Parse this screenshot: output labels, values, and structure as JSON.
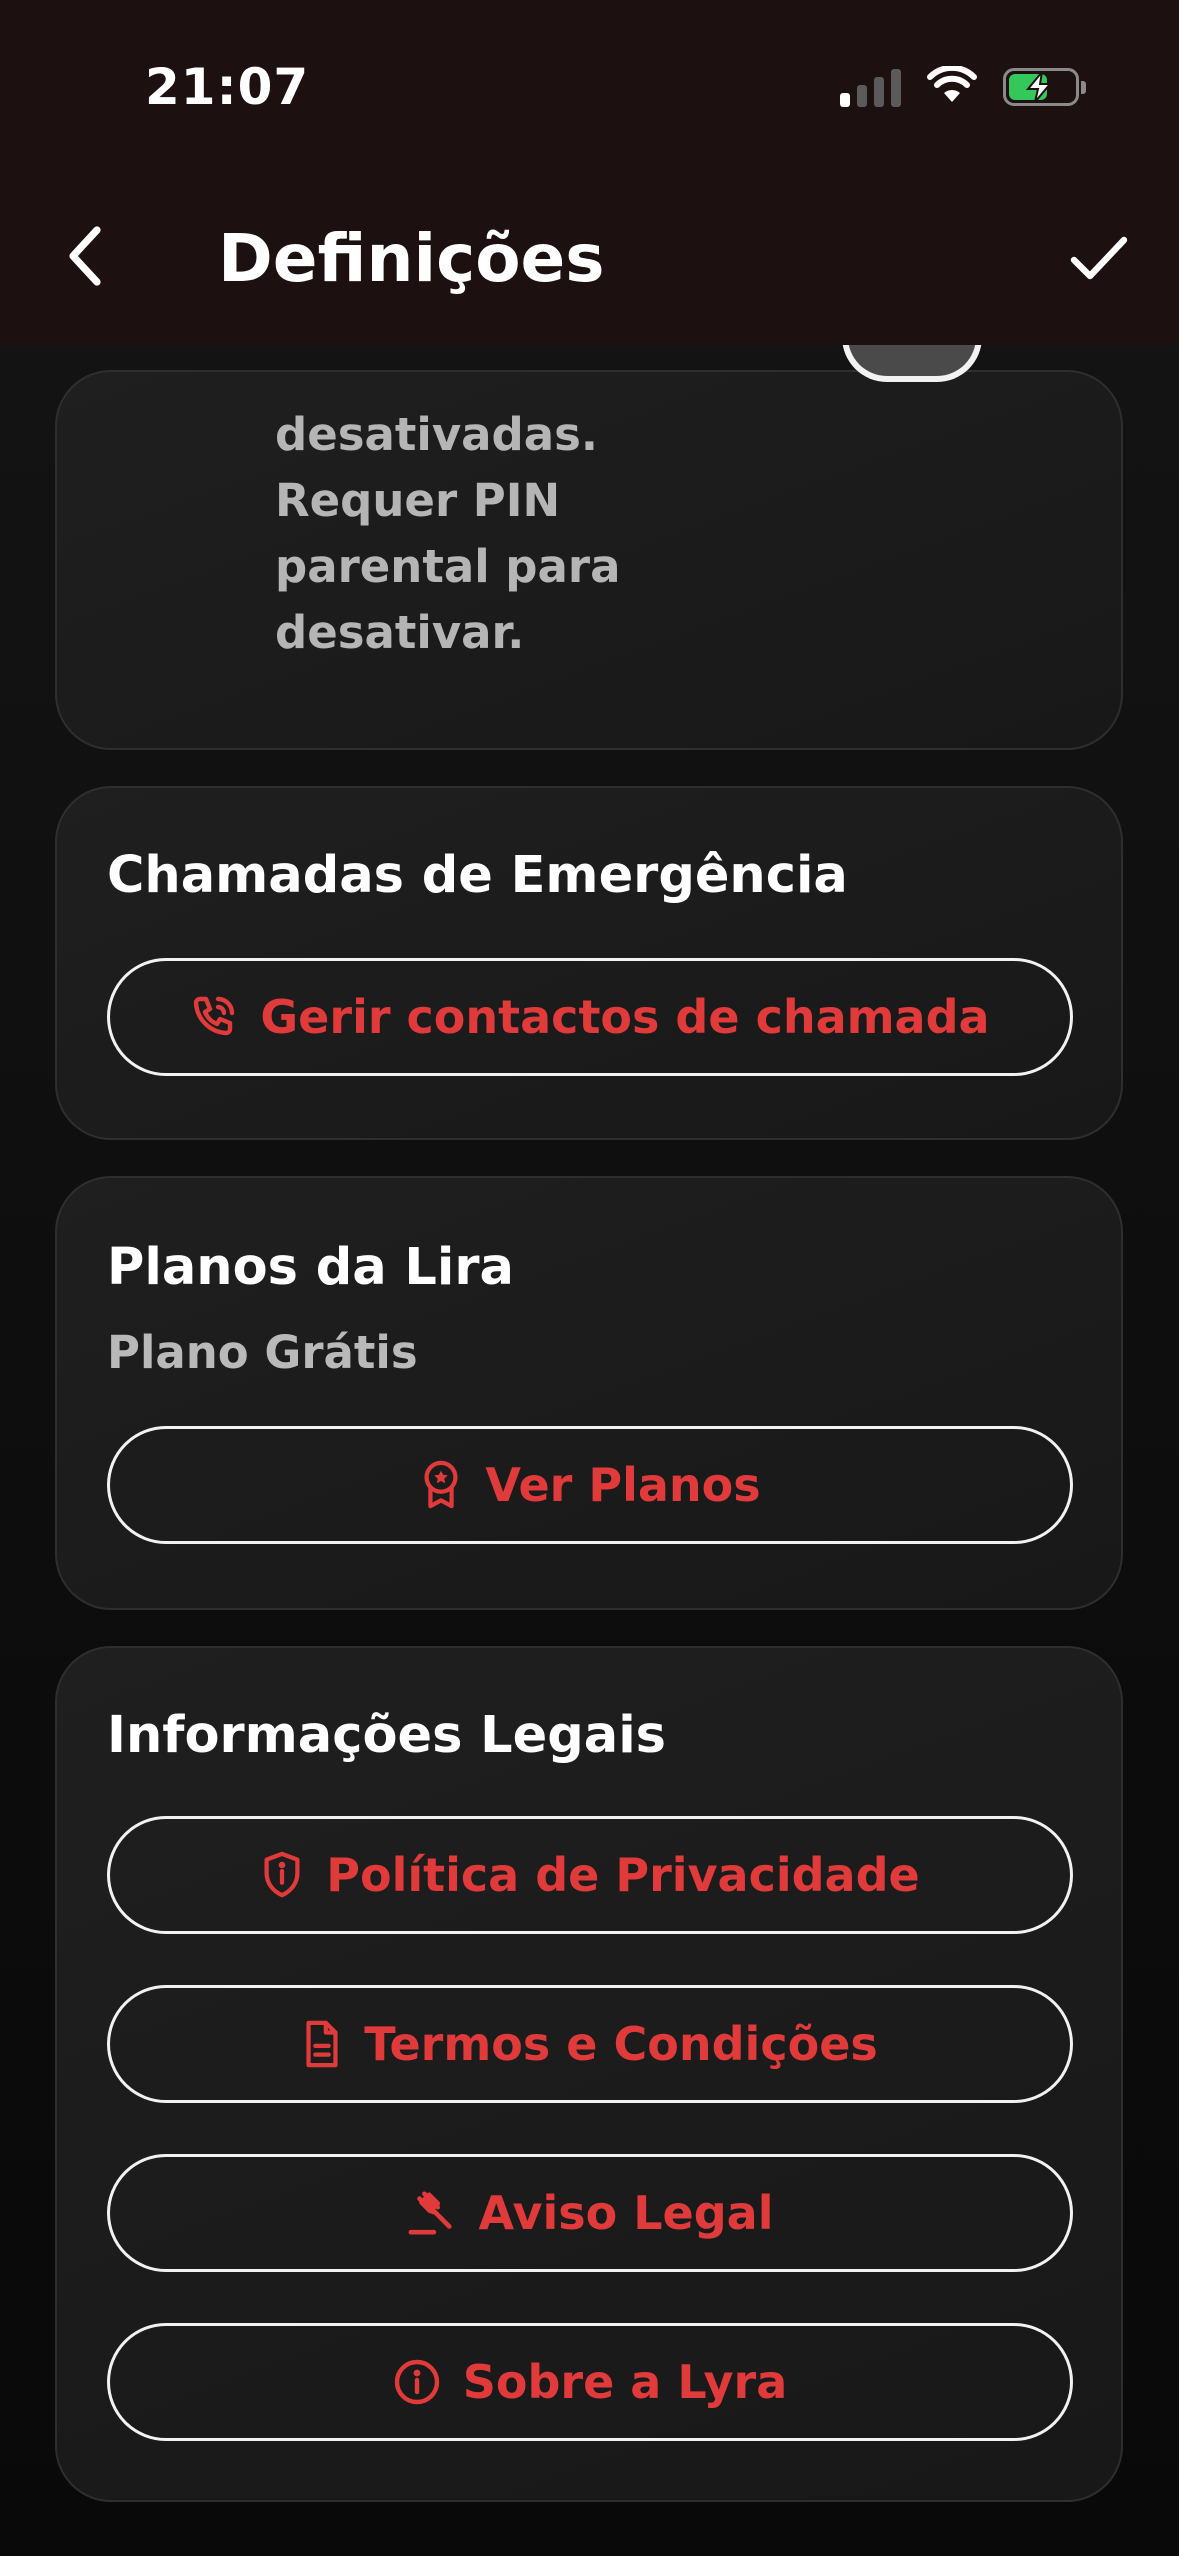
{
  "status_bar": {
    "time": "21:07"
  },
  "header": {
    "title": "Definições",
    "back_icon": "chevron-left-icon",
    "confirm_icon": "checkmark-icon"
  },
  "parental_card": {
    "description_lines": [
      "desativadas.",
      "Requer PIN",
      "parental para",
      "desativar."
    ]
  },
  "emergency": {
    "title": "Chamadas de Emergência",
    "button_label": "Gerir contactos de chamada",
    "button_icon": "phone-call-icon"
  },
  "plans": {
    "title": "Planos da Lira",
    "current_plan": "Plano Grátis",
    "button_label": "Ver Planos",
    "button_icon": "award-badge-icon"
  },
  "legal": {
    "title": "Informações Legais",
    "buttons": [
      {
        "label": "Política de Privacidade",
        "icon": "shield-info-icon"
      },
      {
        "label": "Termos e Condições",
        "icon": "document-icon"
      },
      {
        "label": "Aviso Legal",
        "icon": "gavel-icon"
      },
      {
        "label": "Sobre a Lyra",
        "icon": "info-icon"
      }
    ]
  },
  "colors": {
    "accent": "#e13a3a",
    "header_bg": "#1c1010",
    "card_bg": "#1c1c1c",
    "battery_charging": "#34c759"
  }
}
